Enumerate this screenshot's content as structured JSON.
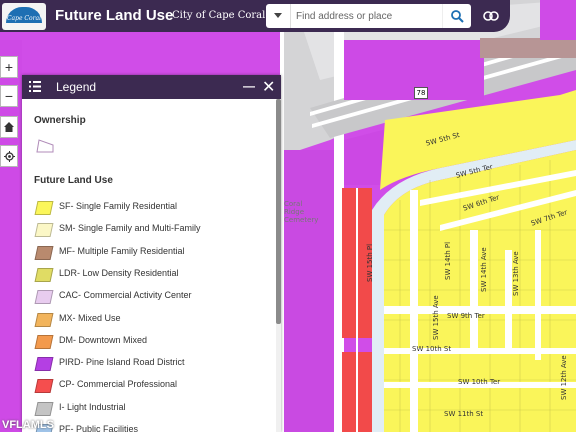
{
  "header": {
    "logo_text": "Cape Coral",
    "title": "Future Land Use",
    "subtitle": "City of Cape Coral GIS",
    "search_placeholder": "Find address or place"
  },
  "map_controls": {
    "zoom_in": "+",
    "zoom_out": "−"
  },
  "map": {
    "highway_shield": "78",
    "streets": [
      "SW 5th St",
      "SW 5th Ter",
      "SW 6th Ter",
      "SW 7th Ter",
      "SW 14th Pl",
      "SW 14th Ave",
      "SW 13th Ave",
      "SW 15th Pl",
      "SW 15th Ave",
      "SW 9th Ter",
      "SW 10th St",
      "SW 10th Ter",
      "SW 11th St",
      "SW 12th Ave"
    ],
    "feature_label": "Coral Ridge Cemetery"
  },
  "legend": {
    "title": "Legend",
    "ownership_heading": "Ownership",
    "flu_heading": "Future Land Use",
    "items": [
      {
        "label": "SF- Single Family Residential",
        "color": "#fbf65a"
      },
      {
        "label": "SM- Single Family and Multi-Family",
        "color": "#fbf7c6"
      },
      {
        "label": "MF- Multiple Family Residential",
        "color": "#b98a6e"
      },
      {
        "label": "LDR- Low Density Residential",
        "color": "#e0dc64"
      },
      {
        "label": "CAC- Commercial Activity Center",
        "color": "#e8ccef"
      },
      {
        "label": "MX- Mixed Use",
        "color": "#f2b45c"
      },
      {
        "label": "DM- Downtown Mixed",
        "color": "#f39a4d"
      },
      {
        "label": "PIRD- Pine Island Road District",
        "color": "#b43fe3"
      },
      {
        "label": "CP- Commercial Professional",
        "color": "#f54e4e"
      },
      {
        "label": "I- Light Industrial",
        "color": "#c4c4c4"
      },
      {
        "label": "PF- Public Facilities",
        "color": "#9fc3e8"
      }
    ]
  },
  "watermark": "VFLAMLS"
}
